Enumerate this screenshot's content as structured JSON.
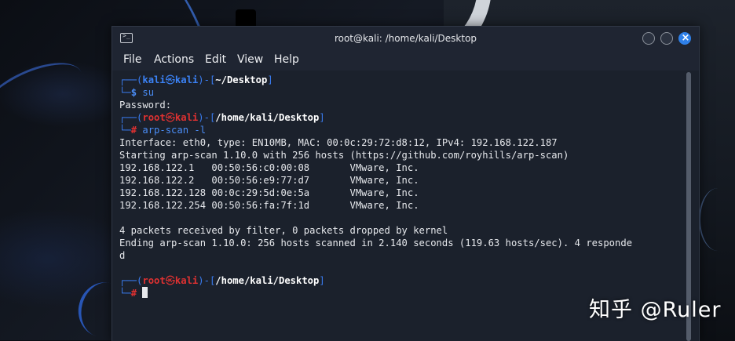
{
  "window": {
    "title": "root@kali: /home/kali/Desktop",
    "icon": "terminal-icon",
    "close_symbol": "×"
  },
  "menu": {
    "file": "File",
    "actions": "Actions",
    "edit": "Edit",
    "view": "View",
    "help": "Help"
  },
  "terminal": {
    "p1": {
      "top": "┌──(",
      "user": "kali",
      "at": "㉿",
      "host": "kali",
      "mid": ")-[",
      "path": "~/Desktop",
      "end": "]",
      "corner": "└─",
      "sym": "$",
      "cmd": " su"
    },
    "password": "Password:",
    "p2": {
      "top": "┌──(",
      "user": "root",
      "at": "㉿",
      "host": "kali",
      "mid": ")-[",
      "path": "/home/kali/Desktop",
      "end": "]",
      "corner": "└─",
      "sym": "#",
      "cmd": " arp-scan -l"
    },
    "out1": "Interface: eth0, type: EN10MB, MAC: 00:0c:29:72:d8:12, IPv4: 192.168.122.187",
    "out2": "Starting arp-scan 1.10.0 with 256 hosts (https://github.com/royhills/arp-scan)",
    "hosts": [
      "192.168.122.1   00:50:56:c0:00:08       VMware, Inc.",
      "192.168.122.2   00:50:56:e9:77:d7       VMware, Inc.",
      "192.168.122.128 00:0c:29:5d:0e:5a       VMware, Inc.",
      "192.168.122.254 00:50:56:fa:7f:1d       VMware, Inc."
    ],
    "out3": "4 packets received by filter, 0 packets dropped by kernel",
    "out4": "Ending arp-scan 1.10.0: 256 hosts scanned in 2.140 seconds (119.63 hosts/sec). 4 responde",
    "out5": "d",
    "p3": {
      "top": "┌──(",
      "user": "root",
      "at": "㉿",
      "host": "kali",
      "mid": ")-[",
      "path": "/home/kali/Desktop",
      "end": "]",
      "corner": "└─",
      "sym": "#"
    }
  },
  "watermark": "知乎 @Ruler",
  "colors": {
    "prompt_blue": "#3b82f6",
    "root_red": "#e03131",
    "terminal_bg": "#1b212c",
    "close_button": "#2f80e8"
  }
}
